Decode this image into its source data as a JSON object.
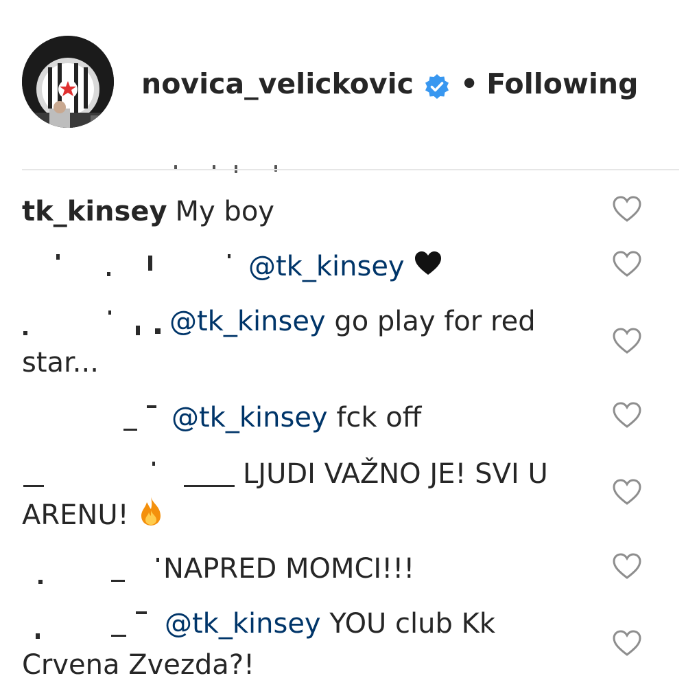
{
  "post": {
    "username": "novica_velickovic",
    "separator": "•",
    "follow_status": "Following",
    "verified": true
  },
  "colors": {
    "text": "#262626",
    "verified_badge": "#3897f0",
    "divider": "#e6e6e6",
    "heart_outline": "#8e8e8e"
  },
  "comments": [
    {
      "author": "tk_kinsey",
      "text": "My boy",
      "icon": "heart-outline-icon"
    },
    {
      "author": "",
      "text": "@tk_kinsey",
      "trailing_emoji": "black-heart-emoji",
      "icon": "heart-outline-icon"
    },
    {
      "author": "",
      "text": "@tk_kinsey go play for red star...",
      "icon": "heart-outline-icon"
    },
    {
      "author": "",
      "text": "@tk_kinsey fck off",
      "icon": "heart-outline-icon"
    },
    {
      "author": "",
      "text": "LJUDI VAŽNO JE! SVI U ARENU!",
      "trailing_emoji": "fire-emoji",
      "icon": "heart-outline-icon"
    },
    {
      "author": "",
      "text": "NAPRED MOMCI!!!",
      "icon": "heart-outline-icon"
    },
    {
      "author": "",
      "text": "@tk_kinsey YOU club Kk Crvena Zvezda?!",
      "icon": "heart-outline-icon"
    }
  ],
  "comment_parts": {
    "c1_author": "tk_kinsey",
    "c1_text": "My boy",
    "c2_mention": "@tk_kinsey",
    "c3_mention": "@tk_kinsey",
    "c3_line1": " go play for red",
    "c3_line2": "star...",
    "c4_mention": "@tk_kinsey",
    "c4_text": " fck off",
    "c5_line1": "LJUDI VAŽNO JE! SVI U",
    "c5_line2": "ARENU!",
    "c6_text": "NAPRED MOMCI!!!",
    "c7_mention": "@tk_kinsey",
    "c7_line1": " YOU club Kk",
    "c7_line2": "Crvena Zvezda?!"
  }
}
